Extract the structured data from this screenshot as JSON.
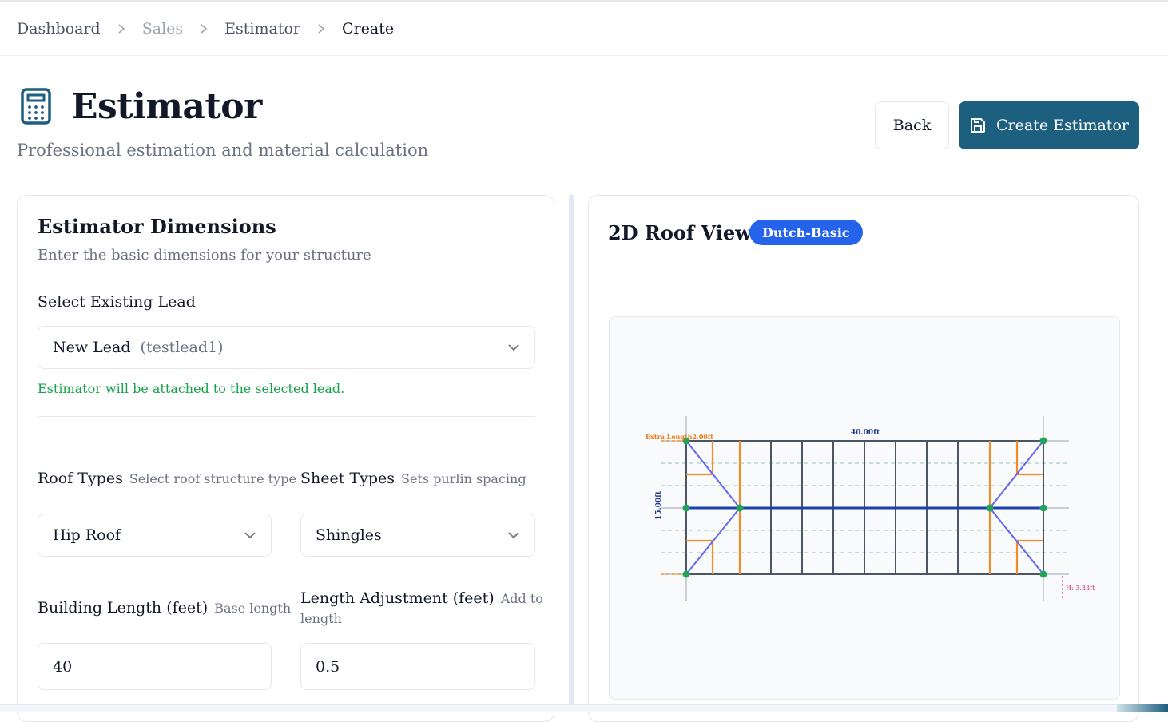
{
  "breadcrumb": {
    "items": [
      "Dashboard",
      "Sales",
      "Estimator",
      "Create"
    ]
  },
  "header": {
    "title": "Estimator",
    "subtitle": "Professional estimation and material calculation",
    "icon": "calculator-icon",
    "back_label": "Back",
    "create_label": "Create Estimator",
    "accent_color": "#1d5f7f"
  },
  "dimensions": {
    "title": "Estimator Dimensions",
    "description": "Enter the basic dimensions for your structure",
    "lead": {
      "label": "Select Existing Lead",
      "value": "New Lead",
      "value_sub": "(testlead1)",
      "help": "Estimator will be attached to the selected lead."
    },
    "roof_type": {
      "label": "Roof Types",
      "hint": "Select roof structure type",
      "value": "Hip Roof"
    },
    "sheet_type": {
      "label": "Sheet Types",
      "hint": "Sets purlin spacing",
      "value": "Shingles"
    },
    "building_length": {
      "label": "Building Length (feet)",
      "hint": "Base length",
      "value": "40"
    },
    "length_adjustment": {
      "label": "Length Adjustment (feet)",
      "hint": "Add to",
      "hint2": "length",
      "value": "0.5"
    }
  },
  "roof_view": {
    "title": "2D Roof View",
    "badge": "Dutch-Basic",
    "badge_color": "#2563eb",
    "diagram": {
      "length_label": "40.00ft",
      "width_label": "15.00ft",
      "extra_label": "Extra Length2.00ft",
      "height_label": "H: 3.33ft"
    }
  }
}
